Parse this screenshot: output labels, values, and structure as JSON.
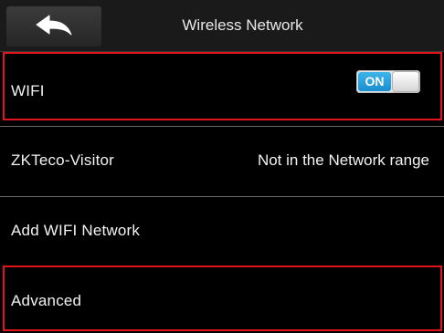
{
  "header": {
    "title": "Wireless Network",
    "back_icon": "back-arrow-icon"
  },
  "rows": [
    {
      "label": "WIFI",
      "toggle": {
        "state_label": "ON",
        "on": true
      }
    },
    {
      "label": "ZKTeco-Visitor",
      "value": "Not in the Network range"
    },
    {
      "label": "Add WIFI Network"
    },
    {
      "label": "Advanced"
    }
  ],
  "colors": {
    "highlight": "#e0141c",
    "toggle_on": "#1b8fcf",
    "background": "#000000"
  }
}
